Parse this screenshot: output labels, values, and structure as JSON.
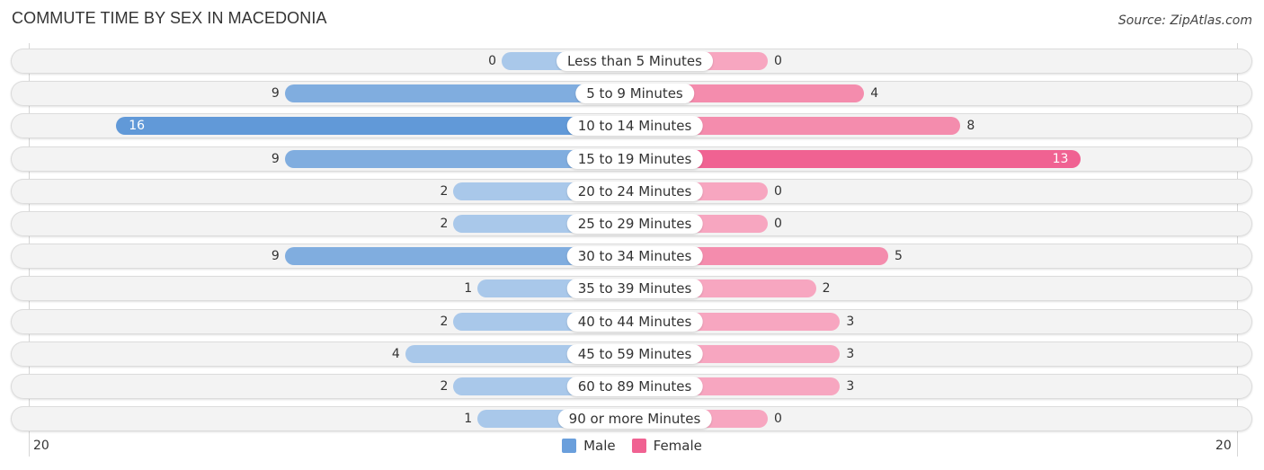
{
  "chart_data": {
    "type": "bar",
    "orientation": "horizontal-diverging",
    "title": "COMMUTE TIME BY SEX IN MACEDONIA",
    "source": "Source: ZipAtlas.com",
    "categories": [
      "Less than 5 Minutes",
      "5 to 9 Minutes",
      "10 to 14 Minutes",
      "15 to 19 Minutes",
      "20 to 24 Minutes",
      "25 to 29 Minutes",
      "30 to 34 Minutes",
      "35 to 39 Minutes",
      "40 to 44 Minutes",
      "45 to 59 Minutes",
      "60 to 89 Minutes",
      "90 or more Minutes"
    ],
    "series": [
      {
        "name": "Male",
        "color": "#6a9fdc",
        "light_color": "#a9c8ea",
        "values": [
          0,
          9,
          16,
          9,
          2,
          2,
          9,
          1,
          2,
          4,
          2,
          1
        ]
      },
      {
        "name": "Female",
        "color": "#f06292",
        "light_color": "#f7a6c0",
        "values": [
          0,
          4,
          8,
          13,
          0,
          0,
          5,
          2,
          3,
          3,
          3,
          0
        ]
      }
    ],
    "xlim": [
      -20,
      20
    ],
    "axis_ticks": {
      "left": "20",
      "right": "20"
    },
    "legend": {
      "position": "bottom-center",
      "entries": [
        "Male",
        "Female"
      ]
    },
    "grid": false
  }
}
